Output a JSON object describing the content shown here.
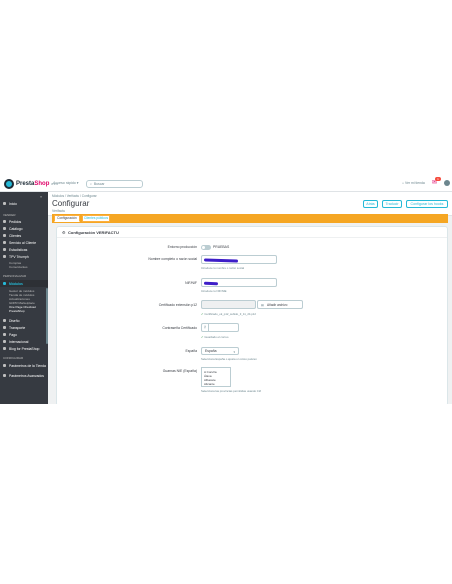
{
  "header": {
    "logo_prefix": "Presta",
    "logo_suffix": "Shop",
    "version": "8.1.0",
    "quick_access": "Acceso rápido ▾",
    "search_placeholder": "Buscar",
    "view_store": "Ver mi tienda",
    "notifications": "1"
  },
  "sidebar": {
    "collapse_glyph": "«",
    "items": [
      {
        "label": "Inicio"
      },
      {
        "label": "Vender"
      },
      {
        "label": "Pedidos"
      },
      {
        "label": "Catálogo"
      },
      {
        "label": "Clientes"
      },
      {
        "label": "Servicio al Cliente"
      },
      {
        "label": "Estadísticas"
      },
      {
        "label": "TPV Triumph"
      }
    ],
    "subs_tpv": [
      "Compras",
      "Comerciantes"
    ],
    "section_personalize": "Personalizar",
    "modules": "Módulos",
    "modules_subs": [
      "Gestor de módulos",
      "Tienda de módulos",
      "Actualizaciones",
      "GDPR Marketplace",
      "One Page Checkout PrestaShop"
    ],
    "after": [
      {
        "label": "Diseño"
      },
      {
        "label": "Transporte"
      },
      {
        "label": "Pago"
      },
      {
        "label": "Internacional"
      },
      {
        "label": "Blog for PrestaShop"
      }
    ],
    "section_config": "Configurar",
    "config_items": [
      {
        "label": "Parámetros de la Tienda"
      },
      {
        "label": "Parámetros Avanzados"
      }
    ]
  },
  "page": {
    "breadcrumb": "Módulos / Verifactu / Configurar",
    "title": "Configurar",
    "subtitle": "Verifactu",
    "buttons": [
      "Atrás",
      "Traducir",
      "Configurar los hooks"
    ]
  },
  "tabs": [
    "Configuración",
    "Clientes públicos"
  ],
  "panel": {
    "title": "Configuración VERIFACTU",
    "fields": {
      "production_label": "Entorno producción",
      "production_value": "PRUEBAS",
      "name_label": "Nombre completo o razón social",
      "name_help": "Introduce tu nombre o razón social",
      "nif_label": "NIF/NIF",
      "nif_help": "Introduce tu NIF/NIE",
      "cert_label": "Certificado extensión p12",
      "cert_button": "Añadir archivo",
      "cert_ok": "Certificado_ok_p12_subido_3_11_24.p12",
      "pass_label": "Contraseña Certificado",
      "pass_ok": "Guardado el correo",
      "country_label": "España",
      "country_value": "España",
      "country_help": "Selecciona España o ajusta un único país/en",
      "province_label": "Guarnas NIE (España)",
      "province_options": [
        "A Coruña",
        "Álava",
        "Albacete",
        "Alicante"
      ],
      "province_help": "Selecciona las provincias permitidas usando Ctrl"
    }
  }
}
